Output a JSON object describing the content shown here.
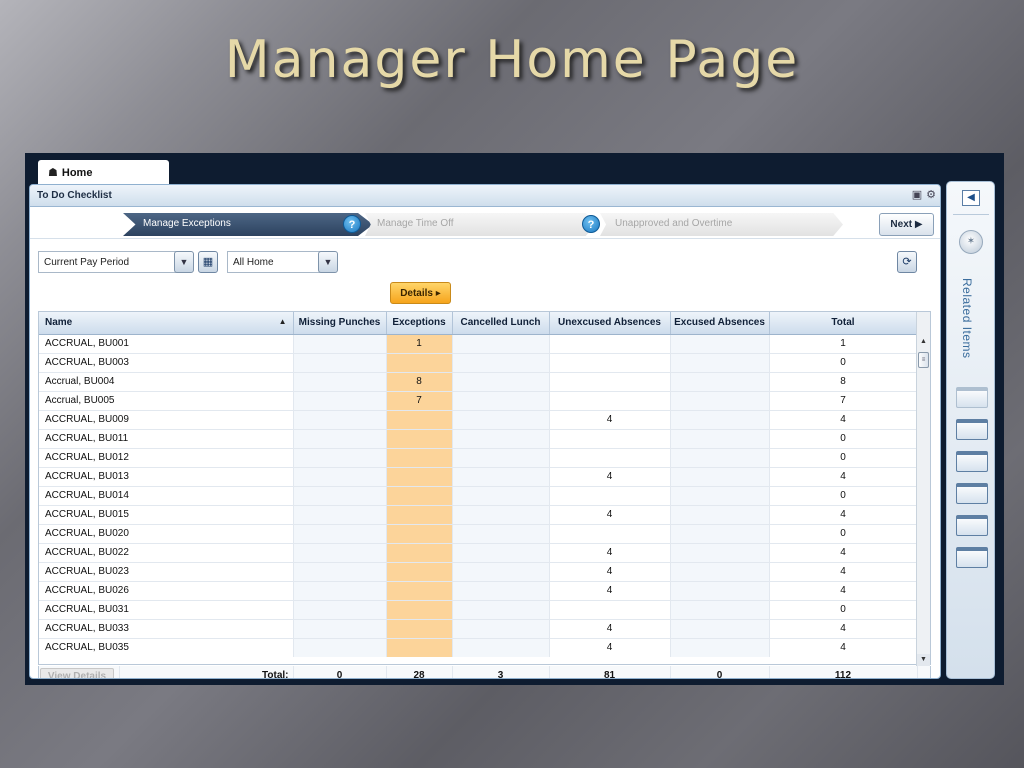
{
  "slide": {
    "title": "Manager Home Page"
  },
  "tab": {
    "home_label": "Home",
    "home_icon": "home-icon"
  },
  "panel": {
    "title": "To Do Checklist",
    "tools": [
      "maximize-icon",
      "gear-icon"
    ]
  },
  "wizard": {
    "steps": [
      {
        "label": "Manage Exceptions",
        "active": true
      },
      {
        "label": "Manage Time Off",
        "active": false
      },
      {
        "label": "Unapproved and Overtime",
        "active": false
      }
    ],
    "help_glyph": "?",
    "next_label": "Next"
  },
  "filters": {
    "pay_period": "Current Pay Period",
    "location": "All Home"
  },
  "details_button": "Details",
  "grid": {
    "columns": [
      "Name",
      "Missing Punches",
      "Exceptions",
      "Cancelled Lunch",
      "Unexcused Absences",
      "Excused Absences",
      "Total"
    ],
    "rows": [
      [
        "ACCRUAL, BU001",
        "",
        "1",
        "",
        "",
        "",
        "1"
      ],
      [
        "ACCRUAL, BU003",
        "",
        "",
        "",
        "",
        "",
        "0"
      ],
      [
        "Accrual, BU004",
        "",
        "8",
        "",
        "",
        "",
        "8"
      ],
      [
        "Accrual, BU005",
        "",
        "7",
        "",
        "",
        "",
        "7"
      ],
      [
        "ACCRUAL, BU009",
        "",
        "",
        "",
        "4",
        "",
        "4"
      ],
      [
        "ACCRUAL, BU011",
        "",
        "",
        "",
        "",
        "",
        "0"
      ],
      [
        "ACCRUAL, BU012",
        "",
        "",
        "",
        "",
        "",
        "0"
      ],
      [
        "ACCRUAL, BU013",
        "",
        "",
        "",
        "4",
        "",
        "4"
      ],
      [
        "ACCRUAL, BU014",
        "",
        "",
        "",
        "",
        "",
        "0"
      ],
      [
        "ACCRUAL, BU015",
        "",
        "",
        "",
        "4",
        "",
        "4"
      ],
      [
        "ACCRUAL, BU020",
        "",
        "",
        "",
        "",
        "",
        "0"
      ],
      [
        "ACCRUAL, BU022",
        "",
        "",
        "",
        "4",
        "",
        "4"
      ],
      [
        "ACCRUAL, BU023",
        "",
        "",
        "",
        "4",
        "",
        "4"
      ],
      [
        "ACCRUAL, BU026",
        "",
        "",
        "",
        "4",
        "",
        "4"
      ],
      [
        "ACCRUAL, BU031",
        "",
        "",
        "",
        "",
        "",
        "0"
      ],
      [
        "ACCRUAL, BU033",
        "",
        "",
        "",
        "4",
        "",
        "4"
      ],
      [
        "ACCRUAL, BU035",
        "",
        "",
        "",
        "4",
        "",
        "4"
      ]
    ],
    "totals": {
      "view_details": "View Details",
      "label": "Total:",
      "values": [
        "0",
        "28",
        "3",
        "81",
        "0",
        "112"
      ]
    }
  },
  "related": {
    "label": "Related Items"
  },
  "colors": {
    "exceptions_highlight": "#fcd49a",
    "active_step": "#2c425f",
    "details_button": "#f6a41c"
  }
}
